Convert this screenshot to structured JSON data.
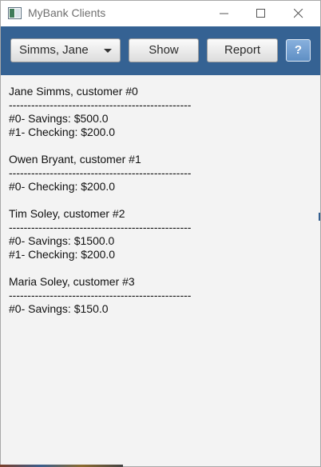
{
  "window": {
    "title": "MyBank Clients",
    "icons": {
      "app": "window-app-icon",
      "minimize": "minimize-icon",
      "maximize": "maximize-icon",
      "close": "close-icon"
    }
  },
  "toolbar": {
    "customer_select": {
      "value": "Simms, Jane",
      "icon": "chevron-down-icon"
    },
    "show_label": "Show",
    "report_label": "Report",
    "help_label": "?"
  },
  "report": {
    "lines": [
      "Jane Simms, customer #0",
      "-------------------------------------------------",
      "#0- Savings: $500.0",
      "#1- Checking: $200.0",
      "",
      "Owen Bryant, customer #1",
      "-------------------------------------------------",
      "#0- Checking: $200.0",
      "",
      "Tim Soley, customer #2",
      "-------------------------------------------------",
      "#0- Savings: $1500.0",
      "#1- Checking: $200.0",
      "",
      "Maria Soley, customer #3",
      "-------------------------------------------------",
      "#0- Savings: $150.0"
    ]
  },
  "colors": {
    "toolbar": "#356293",
    "background": "#f3f3f3",
    "help_button": "#6f9bd0"
  }
}
